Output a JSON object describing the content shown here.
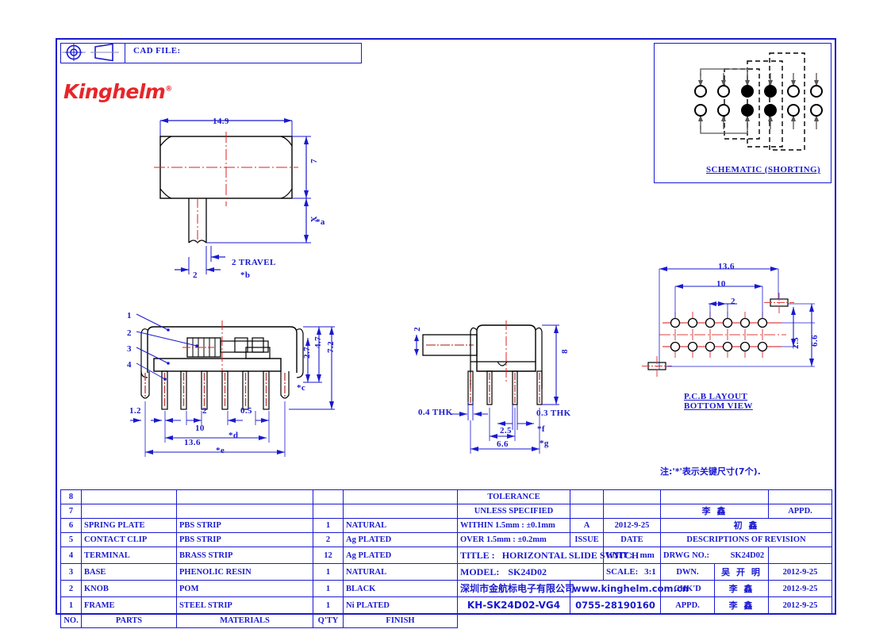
{
  "header": {
    "projection_symbol": "third-angle-projection",
    "cad_file_label": "CAD  FILE:",
    "cad_file_value": ""
  },
  "logo": {
    "text": "Kinghelm",
    "mark": "®",
    "color": "#e8252a"
  },
  "schematic": {
    "caption": "SCHEMATIC  (SHORTING)",
    "columns": 6,
    "rows": 2,
    "filled_columns": [
      3,
      4
    ]
  },
  "views": {
    "top": {
      "dims": {
        "width": "14.9",
        "height": "7",
        "travel_height": "X",
        "star_a": "*a",
        "travel": "2  TRAVEL",
        "star_b": "*b",
        "lever_width": "2"
      }
    },
    "front": {
      "callouts": [
        "1",
        "2",
        "3",
        "4"
      ],
      "dims": {
        "d1": "2.7",
        "d2": "4.7",
        "d3": "7.2",
        "star_c": "*c",
        "left": "1.2",
        "pitch": "2",
        "gap": "0.5",
        "span": "10",
        "star_d": "*d",
        "total": "13.6",
        "star_e": "*e"
      }
    },
    "side": {
      "dims": {
        "lever_thk": "2",
        "height": "8",
        "thk_left": "0.4  THK",
        "thk_right": "0.3  THK",
        "d_25": "2.5",
        "star_f": "*f",
        "d_66": "6.6",
        "star_g": "*g"
      }
    },
    "pcb": {
      "caption_line1": "P.C.B  LAYOUT",
      "caption_line2": "BOTTOM  VIEW",
      "dims": {
        "outer": "13.6",
        "span": "10",
        "pitch": "2",
        "row": "2.5",
        "height": "6.6"
      }
    }
  },
  "note": "注:'*'表示关键尺寸(7个).",
  "parts_table": {
    "headers": {
      "no": "NO.",
      "parts": "PARTS",
      "materials": "MATERIALS",
      "qty": "Q'TY",
      "finish": "FINISH"
    },
    "rows": [
      {
        "no": "8",
        "parts": "",
        "materials": "",
        "qty": "",
        "finish": ""
      },
      {
        "no": "7",
        "parts": "",
        "materials": "",
        "qty": "",
        "finish": ""
      },
      {
        "no": "6",
        "parts": "SPRING  PLATE",
        "materials": "PBS  STRIP",
        "qty": "1",
        "finish": "NATURAL"
      },
      {
        "no": "5",
        "parts": "CONTACT  CLIP",
        "materials": "PBS  STRIP",
        "qty": "2",
        "finish": "Ag  PLATED"
      },
      {
        "no": "4",
        "parts": "TERMINAL",
        "materials": "BRASS  STRIP",
        "qty": "12",
        "finish": "Ag  PLATED"
      },
      {
        "no": "3",
        "parts": "BASE",
        "materials": "PHENOLIC  RESIN",
        "qty": "1",
        "finish": "NATURAL"
      },
      {
        "no": "2",
        "parts": "KNOB",
        "materials": "POM",
        "qty": "1",
        "finish": "BLACK"
      },
      {
        "no": "1",
        "parts": "FRAME",
        "materials": "STEEL  STRIP",
        "qty": "1",
        "finish": "Ni  PLATED"
      }
    ]
  },
  "title_block": {
    "tolerance_title_1": "TOLERANCE",
    "tolerance_title_2": "UNLESS   SPECIFIED",
    "tolerance_within": "WITHIN  1.5mm : ±0.1mm",
    "tolerance_over": "OVER 1.5mm : ±0.2mm",
    "issue_value": "A",
    "issue_label": "ISSUE",
    "date_value": "2012-9-25",
    "date_label": "DATE",
    "revision_sig": "初 鑫",
    "revision_label": "DESCRIPTIONS  OF  REVISION",
    "appd_top_sig": "李 鑫",
    "appd_top_label": "APPD.",
    "title_label": "TITLE :",
    "title_value": "HORIZONTAL  SLIDE  SWITCH",
    "model_label": "MODEL:",
    "model_value": "SK24D02",
    "unit_label": "UNIT :",
    "unit_value": "mm",
    "scale_label": "SCALE:",
    "scale_value": "3:1",
    "drwg_label": "DRWG NO.:",
    "drwg_value": "SK24D02",
    "company_cn": "深圳市金航标电子有限公司",
    "website": "www.kinghelm.com.cn",
    "part_number": "KH-SK24D02-VG4",
    "phone": "0755-28190160",
    "dwn_label": "DWN.",
    "dwn_sig": "吴 开 明",
    "dwn_date": "2012-9-25",
    "chkd_label": "CHK'D",
    "chkd_sig": "李 鑫",
    "chkd_date": "2012-9-25",
    "appd_label": "APPD.",
    "appd_sig": "李 鑫",
    "appd_date": "2012-9-25"
  },
  "colors": {
    "blue": "#1a1ad0",
    "red": "#e8252a",
    "dark_red": "#b03030",
    "black": "#000000"
  }
}
